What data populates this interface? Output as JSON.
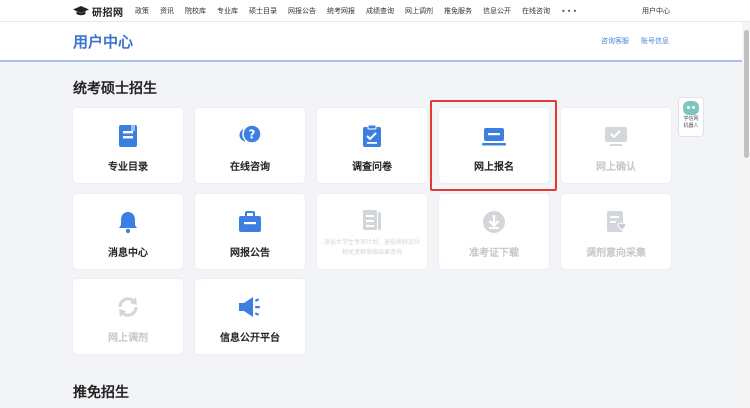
{
  "topnav": {
    "logo": "研招网",
    "items": [
      "政策",
      "资讯",
      "院校库",
      "专业库",
      "硕士目录",
      "网报公告",
      "统考网报",
      "成绩查询",
      "网上调剂",
      "推免服务",
      "信息公开",
      "在线咨询"
    ],
    "more": "•••",
    "user": "用户中心"
  },
  "header": {
    "title": "用户中心",
    "links": [
      "咨询客服",
      "账号信息"
    ]
  },
  "robot": {
    "label_line1": "学信网",
    "label_line2": "机器人"
  },
  "sections": {
    "tongkao": "统考硕士招生",
    "tuimian": "推免招生"
  },
  "cards": [
    {
      "label": "专业目录",
      "icon": "book-icon",
      "enabled": true
    },
    {
      "label": "在线咨询",
      "icon": "chat-question-icon",
      "enabled": true
    },
    {
      "label": "调查问卷",
      "icon": "clipboard-icon",
      "enabled": true
    },
    {
      "label": "网上报名",
      "icon": "laptop-icon",
      "enabled": true
    },
    {
      "label": "网上确认",
      "icon": "monitor-check-icon",
      "enabled": false
    },
    {
      "label": "消息中心",
      "icon": "bell-icon",
      "enabled": true
    },
    {
      "label": "网报公告",
      "icon": "briefcase-icon",
      "enabled": true
    },
    {
      "label": "",
      "note": "退役大学生专项计划、退役高校加分相关资格审核结果查询",
      "icon": "document-icon",
      "enabled": false
    },
    {
      "label": "准考证下载",
      "icon": "download-icon",
      "enabled": false
    },
    {
      "label": "调剂意向采集",
      "icon": "form-heart-icon",
      "enabled": false
    },
    {
      "label": "网上调剂",
      "icon": "refresh-icon",
      "enabled": false
    },
    {
      "label": "信息公开平台",
      "icon": "megaphone-icon",
      "enabled": true
    }
  ],
  "colors": {
    "accent": "#3b73d1",
    "icon_active": "#3d7fe0",
    "icon_disabled": "#d3d6db",
    "highlight": "#e23a30"
  }
}
